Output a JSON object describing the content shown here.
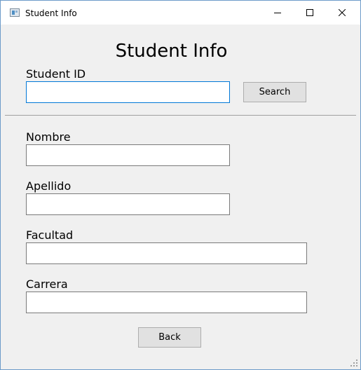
{
  "window": {
    "title": "Student Info",
    "controls": {
      "minimize_icon": "minimize-icon",
      "maximize_icon": "maximize-icon",
      "close_icon": "close-icon"
    }
  },
  "form": {
    "heading": "Student Info",
    "student_id": {
      "label": "Student ID",
      "value": "",
      "placeholder": ""
    },
    "search_label": "Search",
    "nombre": {
      "label": "Nombre",
      "value": ""
    },
    "apellido": {
      "label": "Apellido",
      "value": ""
    },
    "facultad": {
      "label": "Facultad",
      "value": ""
    },
    "carrera": {
      "label": "Carrera",
      "value": ""
    },
    "back_label": "Back"
  },
  "colors": {
    "window_bg": "#f0f0f0",
    "focus_border": "#0078d7",
    "button_bg": "#e1e1e1"
  }
}
